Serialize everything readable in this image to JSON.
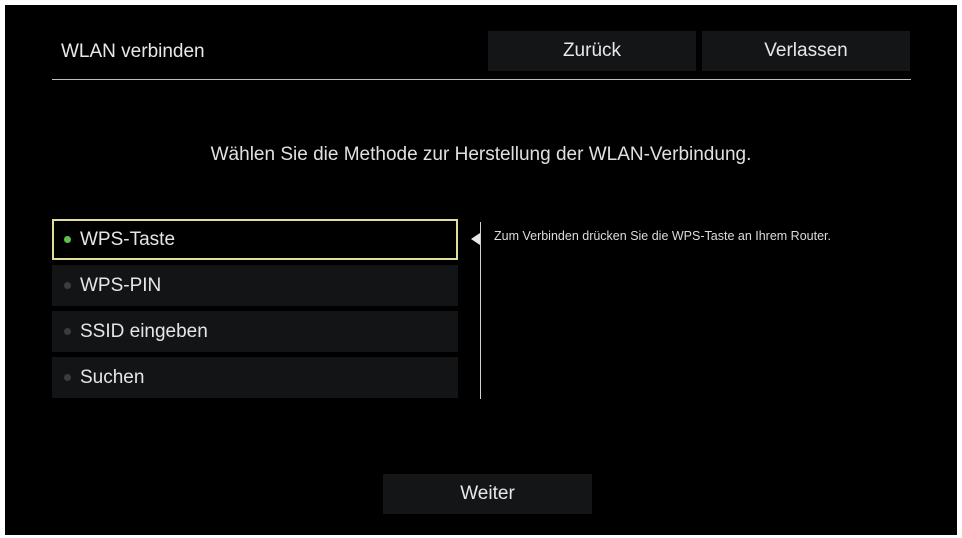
{
  "header": {
    "title": "WLAN verbinden",
    "back_label": "Zurück",
    "exit_label": "Verlassen"
  },
  "instruction": "Wählen Sie die Methode zur Herstellung der WLAN-Verbindung.",
  "methods": [
    {
      "label": "WPS-Taste",
      "selected": true
    },
    {
      "label": "WPS-PIN",
      "selected": false
    },
    {
      "label": "SSID eingeben",
      "selected": false
    },
    {
      "label": "Suchen",
      "selected": false
    }
  ],
  "description": "Zum Verbinden drücken Sie die WPS-Taste an Ihrem Router.",
  "footer": {
    "next_label": "Weiter"
  },
  "colors": {
    "background": "#000000",
    "button_bg": "#131517",
    "selection_border": "#e2de9a",
    "active_dot": "#5fbf4a",
    "inactive_dot": "#3a3d40"
  }
}
